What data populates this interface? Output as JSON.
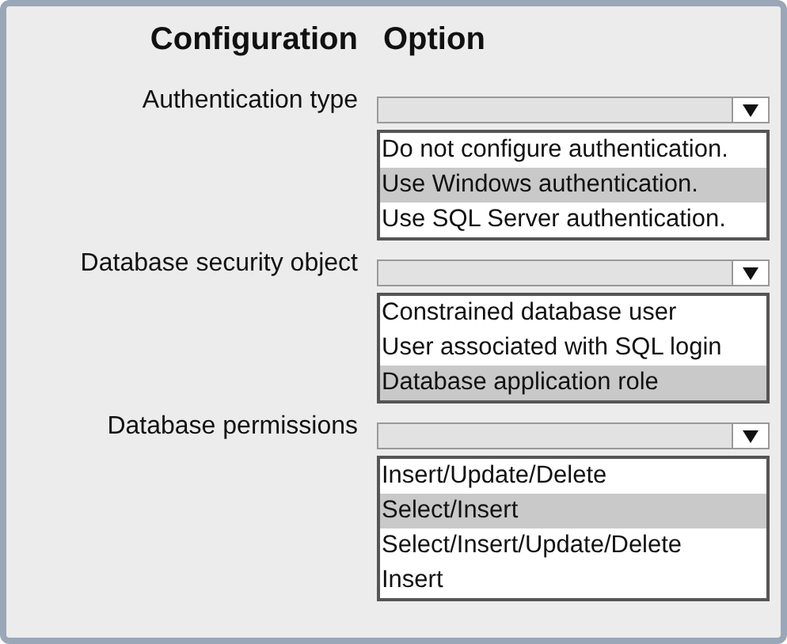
{
  "headers": [
    "Configuration",
    "Option"
  ],
  "rows": [
    {
      "label": "Authentication type",
      "options": [
        {
          "text": "Do not configure authentication.",
          "selected": false
        },
        {
          "text": "Use Windows authentication.",
          "selected": true
        },
        {
          "text": "Use SQL Server authentication.",
          "selected": false
        }
      ]
    },
    {
      "label": "Database security object",
      "options": [
        {
          "text": "Constrained database user",
          "selected": false
        },
        {
          "text": "User associated with SQL login",
          "selected": false
        },
        {
          "text": "Database application role",
          "selected": true
        }
      ]
    },
    {
      "label": "Database permissions",
      "options": [
        {
          "text": "Insert/Update/Delete",
          "selected": false
        },
        {
          "text": "Select/Insert",
          "selected": true
        },
        {
          "text": "Select/Insert/Update/Delete",
          "selected": false
        },
        {
          "text": "Insert",
          "selected": false
        }
      ]
    }
  ]
}
